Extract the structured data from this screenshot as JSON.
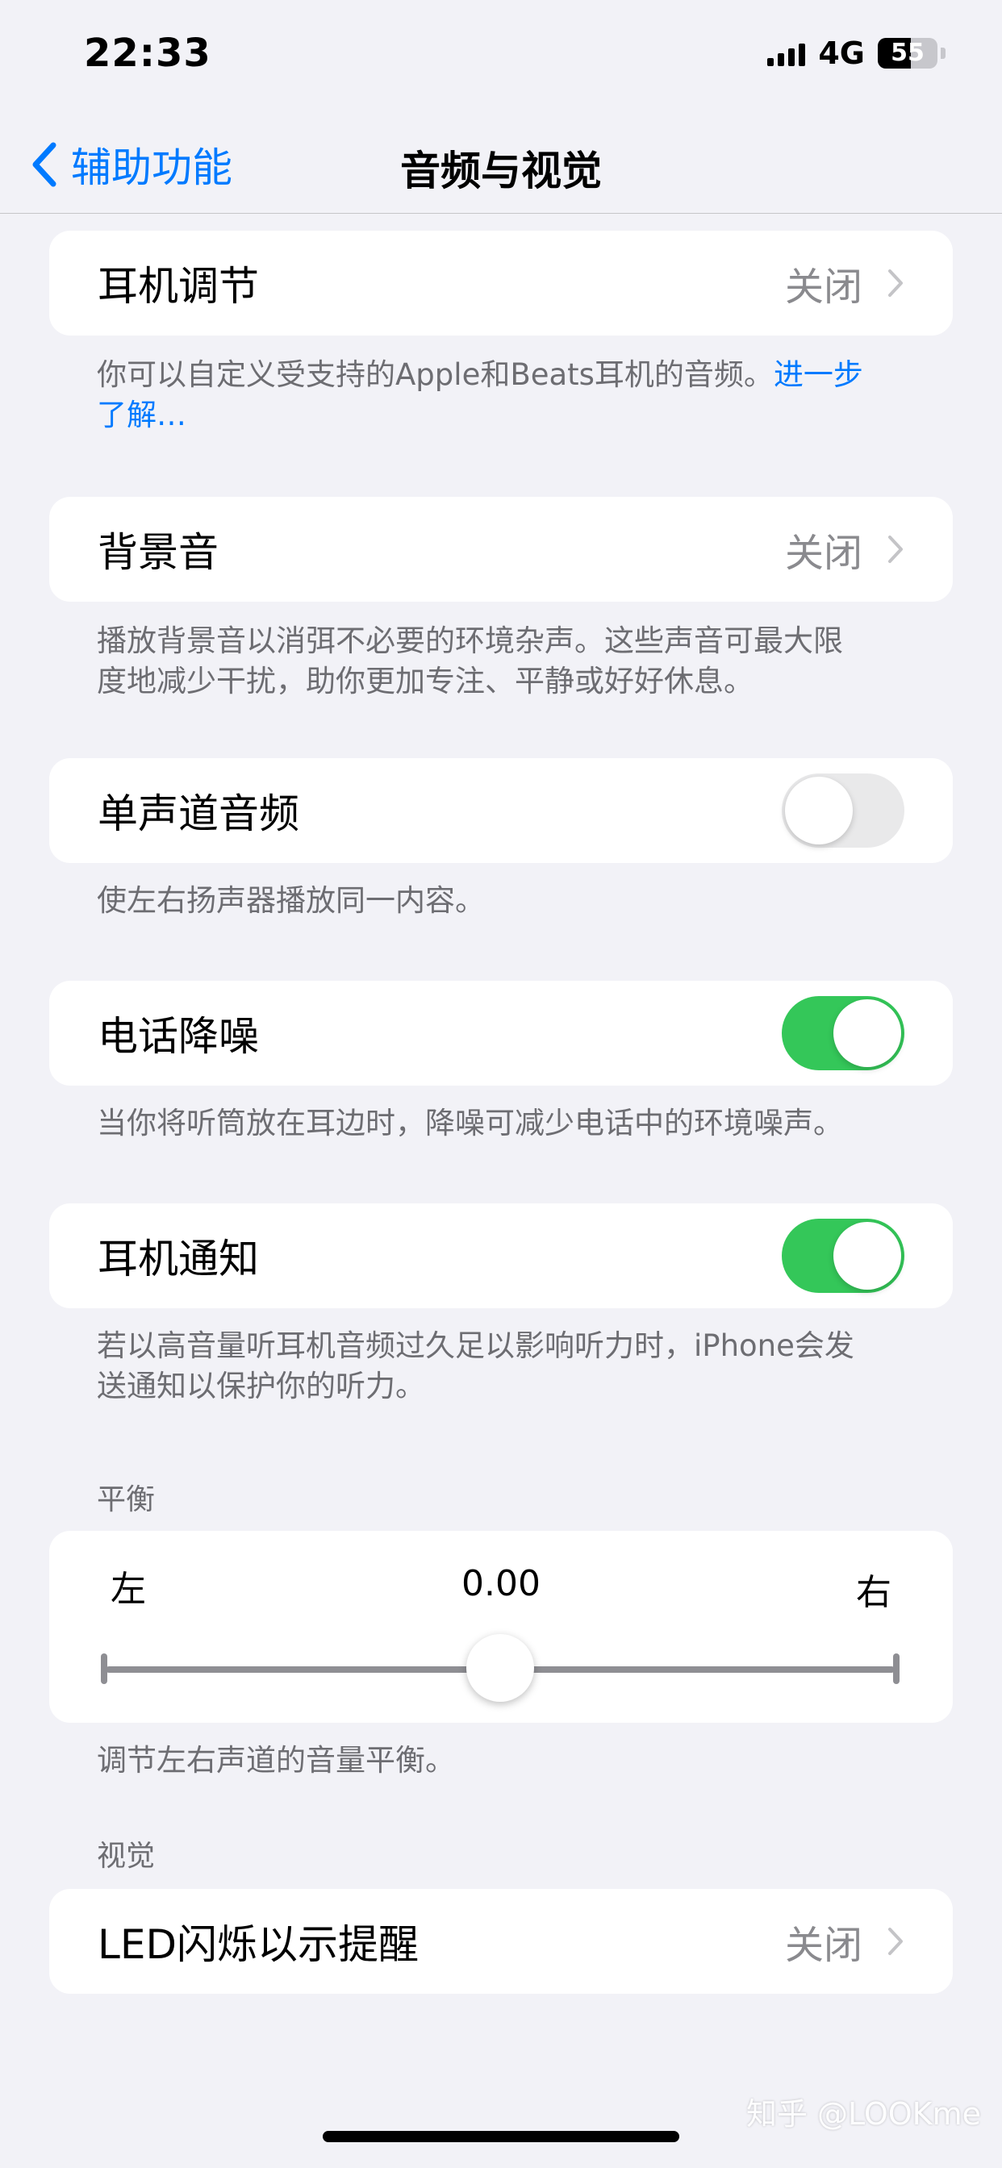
{
  "status_bar": {
    "time": "22:33",
    "network": "4G",
    "battery": "55",
    "battery_level": 0.55
  },
  "nav": {
    "back_label": "辅助功能",
    "title": "音频与视觉"
  },
  "headphone_adjust": {
    "label": "耳机调节",
    "value": "关闭",
    "footer": "你可以自定义受支持的Apple和Beats耳机的音频。",
    "footer_link": "进一步了解…"
  },
  "background_sounds": {
    "label": "背景音",
    "value": "关闭",
    "footer": "播放背景音以消弭不必要的环境杂声。这些声音可最大限度地减少干扰，助你更加专注、平静或好好休息。"
  },
  "mono_audio": {
    "label": "单声道音频",
    "on": false,
    "footer": "使左右扬声器播放同一内容。"
  },
  "phone_noise": {
    "label": "电话降噪",
    "on": true,
    "footer": "当你将听筒放在耳边时，降噪可减少电话中的环境噪声。"
  },
  "headphone_notify": {
    "label": "耳机通知",
    "on": true,
    "footer": "若以高音量听耳机音频过久足以影响听力时，iPhone会发送通知以保护你的听力。"
  },
  "balance": {
    "header": "平衡",
    "left": "左",
    "right": "右",
    "value": "0.00",
    "position": 0.5,
    "footer": "调节左右声道的音量平衡。"
  },
  "visual": {
    "header": "视觉",
    "led_label": "LED闪烁以示提醒",
    "led_value": "关闭"
  },
  "watermark": "知乎 @LOOKme",
  "colors": {
    "accent": "#007aff",
    "toggle_on": "#34c759",
    "background": "#f2f2f7"
  },
  "icons": {
    "back": "chevron-left-icon",
    "disclosure": "chevron-right-icon"
  }
}
